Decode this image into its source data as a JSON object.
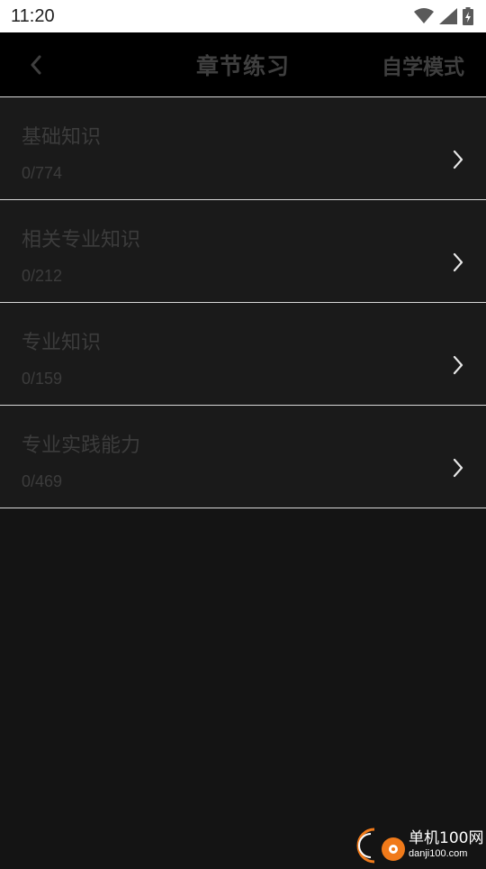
{
  "status_bar": {
    "time": "11:20",
    "icons": [
      "wifi-icon",
      "signal-icon",
      "battery-icon"
    ]
  },
  "nav": {
    "back_icon": "chevron-left-icon",
    "title": "章节练习",
    "mode_label": "自学模式"
  },
  "chapters": [
    {
      "name": "基础知识",
      "progress": "0/774"
    },
    {
      "name": "相关专业知识",
      "progress": "0/212"
    },
    {
      "name": "专业知识",
      "progress": "0/159"
    },
    {
      "name": "专业实践能力",
      "progress": "0/469"
    }
  ],
  "watermark": {
    "text": "单机100网",
    "url": "danji100.com"
  },
  "colors": {
    "background": "#141414",
    "item_background": "#1a1a1a",
    "nav_background": "#000000",
    "divider": "#d8d8d8",
    "text_dim": "#3c3c3c",
    "accent": "#f07a1a"
  }
}
